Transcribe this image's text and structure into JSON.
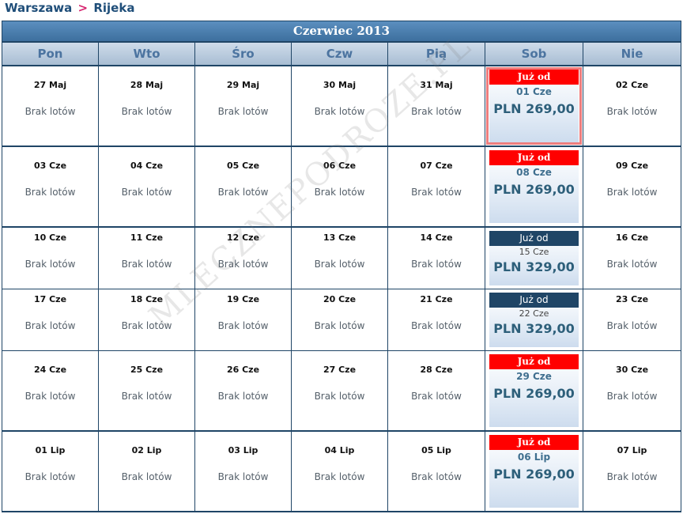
{
  "route": {
    "from": "Warszawa",
    "sep": ">",
    "to": "Rijeka"
  },
  "month": "Czerwiec  2013",
  "days": [
    "Pon",
    "Wto",
    "Śro",
    "Czw",
    "Pią",
    "Sob",
    "Nie"
  ],
  "no_flights": "Brak lotów",
  "offer_label": "Już od",
  "watermark": "MLECZNEPODROZE.PL",
  "weeks": [
    {
      "dates": [
        "27 Maj",
        "28 Maj",
        "29 Maj",
        "30 Maj",
        "31 Maj",
        "01 Cze",
        "02 Cze"
      ],
      "price": "PLN 269,00",
      "style": "red",
      "selected": true
    },
    {
      "dates": [
        "03 Cze",
        "04 Cze",
        "05 Cze",
        "06 Cze",
        "07 Cze",
        "08 Cze",
        "09 Cze"
      ],
      "price": "PLN 269,00",
      "style": "red",
      "selected": false
    },
    {
      "dates": [
        "10 Cze",
        "11 Cze",
        "12 Cze",
        "13 Cze",
        "14 Cze",
        "15 Cze",
        "16 Cze"
      ],
      "price": "PLN 329,00",
      "style": "blue",
      "selected": false
    },
    {
      "dates": [
        "17 Cze",
        "18 Cze",
        "19 Cze",
        "20 Cze",
        "21 Cze",
        "22 Cze",
        "23 Cze"
      ],
      "price": "PLN 329,00",
      "style": "blue",
      "selected": false
    },
    {
      "dates": [
        "24 Cze",
        "25 Cze",
        "26 Cze",
        "27 Cze",
        "28 Cze",
        "29 Cze",
        "30 Cze"
      ],
      "price": "PLN 269,00",
      "style": "red",
      "selected": false
    },
    {
      "dates": [
        "01 Lip",
        "02 Lip",
        "03 Lip",
        "04 Lip",
        "05 Lip",
        "06 Lip",
        "07 Lip"
      ],
      "price": "PLN 269,00",
      "style": "red",
      "selected": false
    }
  ]
}
